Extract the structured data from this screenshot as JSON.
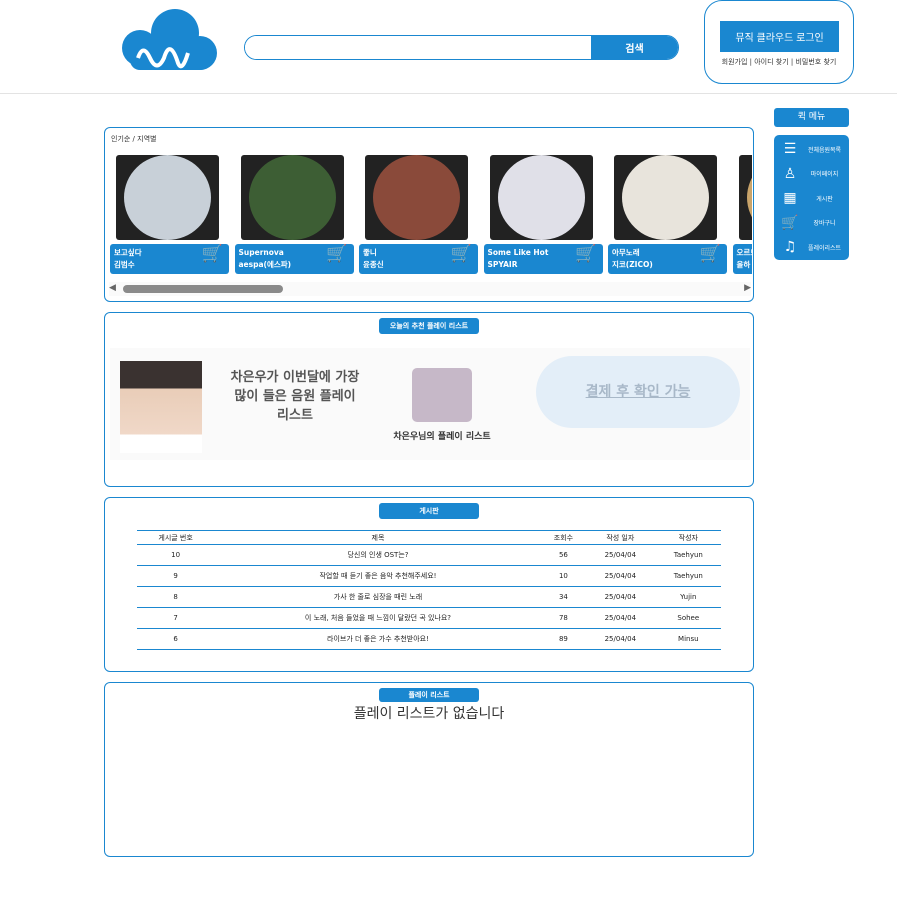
{
  "header": {
    "search_placeholder": "",
    "search_button": "검색",
    "login_button": "뮤직 클라우드 로그인",
    "links": [
      "회원가입",
      "아이디 찾기",
      "비밀번호 찾기"
    ]
  },
  "quick_menu": {
    "title": "퀵 메뉴",
    "items": [
      {
        "icon": "list-icon",
        "glyph": "☰",
        "label": "전체음원목록"
      },
      {
        "icon": "user-icon",
        "glyph": "♙",
        "label": "마이페이지"
      },
      {
        "icon": "board-icon",
        "glyph": "▦",
        "label": "게시판"
      },
      {
        "icon": "cart-icon",
        "glyph": "🛒",
        "label": "장바구니"
      },
      {
        "icon": "playlist-icon",
        "glyph": "♫",
        "label": "플레이리스트"
      }
    ]
  },
  "popular": {
    "breadcrumb": "인기순 / 지역별",
    "songs": [
      {
        "title": "보고싶다",
        "artist": "김범수",
        "color": "#c8d0d8"
      },
      {
        "title": "Supernova",
        "artist": "aespa(에스파)",
        "color": "#3d5e34"
      },
      {
        "title": "좋니",
        "artist": "윤종신",
        "color": "#8a4a3a"
      },
      {
        "title": "Some Like Hot",
        "artist": "SPYAIR",
        "color": "#e0e0e8"
      },
      {
        "title": "아무노래",
        "artist": "지코(ZICO)",
        "color": "#e8e4dc"
      },
      {
        "title": "오르트",
        "artist": "올하",
        "color": "#c9a46a"
      }
    ]
  },
  "recommend": {
    "tag": "오늘의 추천 플레이 리스트",
    "headline": "차은우가 이번달에 가장 많이 들은 음원 플레이 리스트",
    "playlist_name": "차은우님의 플레이 리스트",
    "locked_label": "결제 후 확인 가능"
  },
  "board": {
    "tag": "게시판",
    "columns": [
      "게시글 번호",
      "제목",
      "조회수",
      "작성 일자",
      "작성자"
    ],
    "rows": [
      [
        "10",
        "당신의 인생 OST는?",
        "56",
        "25/04/04",
        "Taehyun"
      ],
      [
        "9",
        "작업할 때 듣기 좋은 음악 추천해주세요!",
        "10",
        "25/04/04",
        "Taehyun"
      ],
      [
        "8",
        "가사 한 줄로 심장을 때린 노래",
        "34",
        "25/04/04",
        "Yujin"
      ],
      [
        "7",
        "이 노래, 처음 들었을 때 느낌이 달랐던 곡 있나요?",
        "78",
        "25/04/04",
        "Sohee"
      ],
      [
        "6",
        "라이브가 더 좋은 가수 추천받아요!",
        "89",
        "25/04/04",
        "Minsu"
      ]
    ]
  },
  "playlist": {
    "tag": "플레이 리스트",
    "empty": "플레이 리스트가 없습니다"
  }
}
